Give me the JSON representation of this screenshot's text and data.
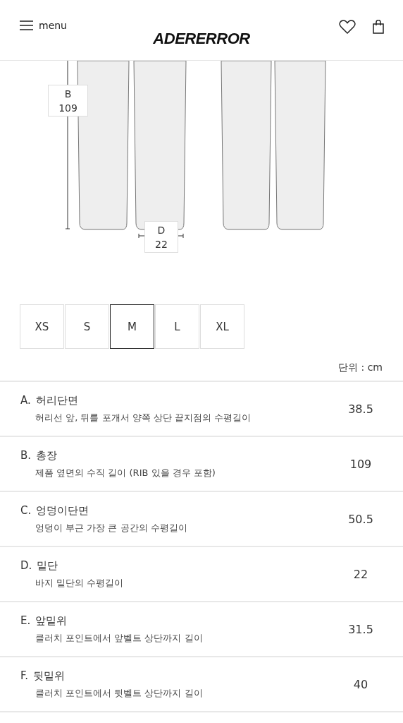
{
  "header": {
    "menu_label": "menu",
    "logo": "ADERERROR"
  },
  "diagram": {
    "labels": [
      {
        "letter": "B",
        "value": "109",
        "kind": "vertical"
      },
      {
        "letter": "D",
        "value": "22",
        "kind": "horizontal"
      }
    ]
  },
  "sizes": [
    {
      "label": "XS",
      "selected": false
    },
    {
      "label": "S",
      "selected": false
    },
    {
      "label": "M",
      "selected": true
    },
    {
      "label": "L",
      "selected": false
    },
    {
      "label": "XL",
      "selected": false
    }
  ],
  "unit": "단위 : cm",
  "measurements": [
    {
      "letter": "A.",
      "name": "허리단면",
      "description": "허리선 앞, 뒤를 포개서 양쪽 상단 끝지점의 수평길이",
      "value": "38.5"
    },
    {
      "letter": "B.",
      "name": "총장",
      "description": "제품 옆면의 수직 길이 (RIB 있을 경우 포함)",
      "value": "109"
    },
    {
      "letter": "C.",
      "name": "엉덩이단면",
      "description": "엉덩이 부근 가장 큰 공간의 수평길이",
      "value": "50.5"
    },
    {
      "letter": "D.",
      "name": "밑단",
      "description": "바지 밑단의 수평길이",
      "value": "22"
    },
    {
      "letter": "E.",
      "name": "앞밑위",
      "description": "클러치 포인트에서 앞벨트 상단까지 길이",
      "value": "31.5"
    },
    {
      "letter": "F.",
      "name": "뒷밑위",
      "description": "클러치 포인트에서 뒷벨트 상단까지 길이",
      "value": "40"
    }
  ]
}
